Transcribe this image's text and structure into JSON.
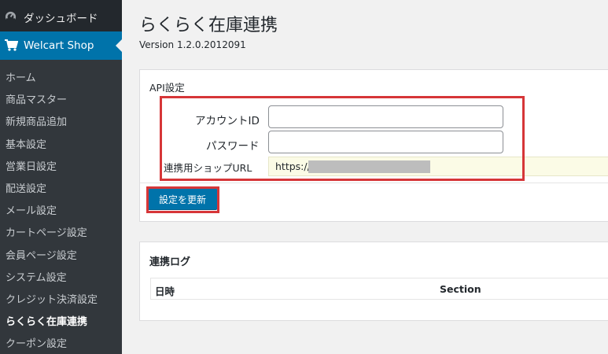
{
  "sidebar": {
    "dashboard_label": "ダッシュボード",
    "active_menu_label": "Welcart Shop",
    "items": [
      {
        "label": "ホーム"
      },
      {
        "label": "商品マスター"
      },
      {
        "label": "新規商品追加"
      },
      {
        "label": "基本設定"
      },
      {
        "label": "営業日設定"
      },
      {
        "label": "配送設定"
      },
      {
        "label": "メール設定"
      },
      {
        "label": "カートページ設定"
      },
      {
        "label": "会員ページ設定"
      },
      {
        "label": "システム設定"
      },
      {
        "label": "クレジット決済設定"
      },
      {
        "label": "らくらく在庫連携",
        "current": true
      },
      {
        "label": "クーポン設定"
      }
    ]
  },
  "page": {
    "title": "らくらく在庫連携",
    "version": "Version 1.2.0.2012091"
  },
  "api_settings": {
    "heading": "API設定",
    "account_id_label": "アカウントID",
    "account_id_value": "",
    "password_label": "パスワード",
    "password_value": "",
    "shop_url_label": "連携用ショップURL",
    "shop_url_value": "https://",
    "save_button_label": "設定を更新"
  },
  "log": {
    "heading": "連携ログ",
    "columns": [
      "日時",
      "Section"
    ]
  },
  "colors": {
    "accent": "#0073aa",
    "highlight": "#d63638"
  }
}
